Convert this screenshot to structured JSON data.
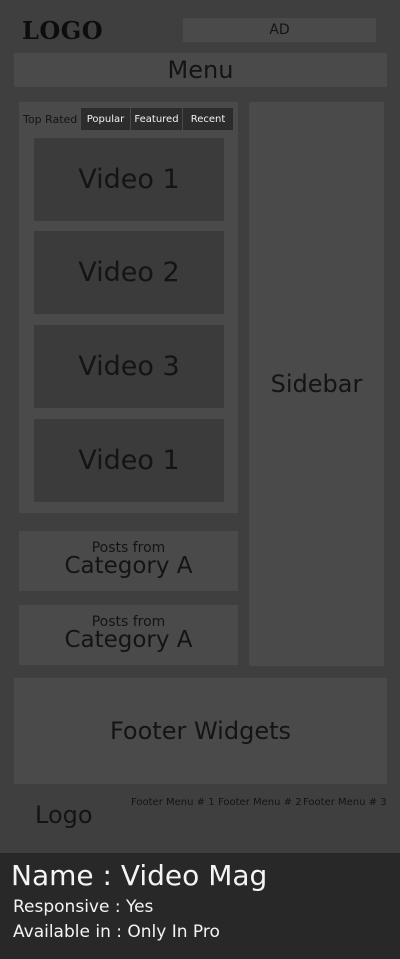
{
  "header": {
    "logo": "LOGO",
    "ad": "AD",
    "menu": "Menu"
  },
  "tabs": [
    "Top Rated",
    "Popular",
    "Featured",
    "Recent"
  ],
  "videos": [
    "Video 1",
    "Video 2",
    "Video 3",
    "Video 1"
  ],
  "sidebar": "Sidebar",
  "posts": [
    {
      "small": "Posts from",
      "big": "Category A"
    },
    {
      "small": "Posts from",
      "big": "Category A"
    }
  ],
  "footer": {
    "widgets": "Footer Widgets",
    "logo": "Logo",
    "menus": [
      "Footer Menu # 1",
      "Footer Menu # 2",
      "Footer Menu # 3"
    ]
  },
  "info": {
    "name": "Name : Video Mag",
    "responsive": "Responsive : Yes",
    "available": "Available in : Only In Pro"
  },
  "colors": {
    "background": "#3f3f3f",
    "panel": "#4a4a4a",
    "video_box": "#3b3b3b",
    "tab_bg": "#2c2c2c",
    "info_bar": "#282828"
  }
}
